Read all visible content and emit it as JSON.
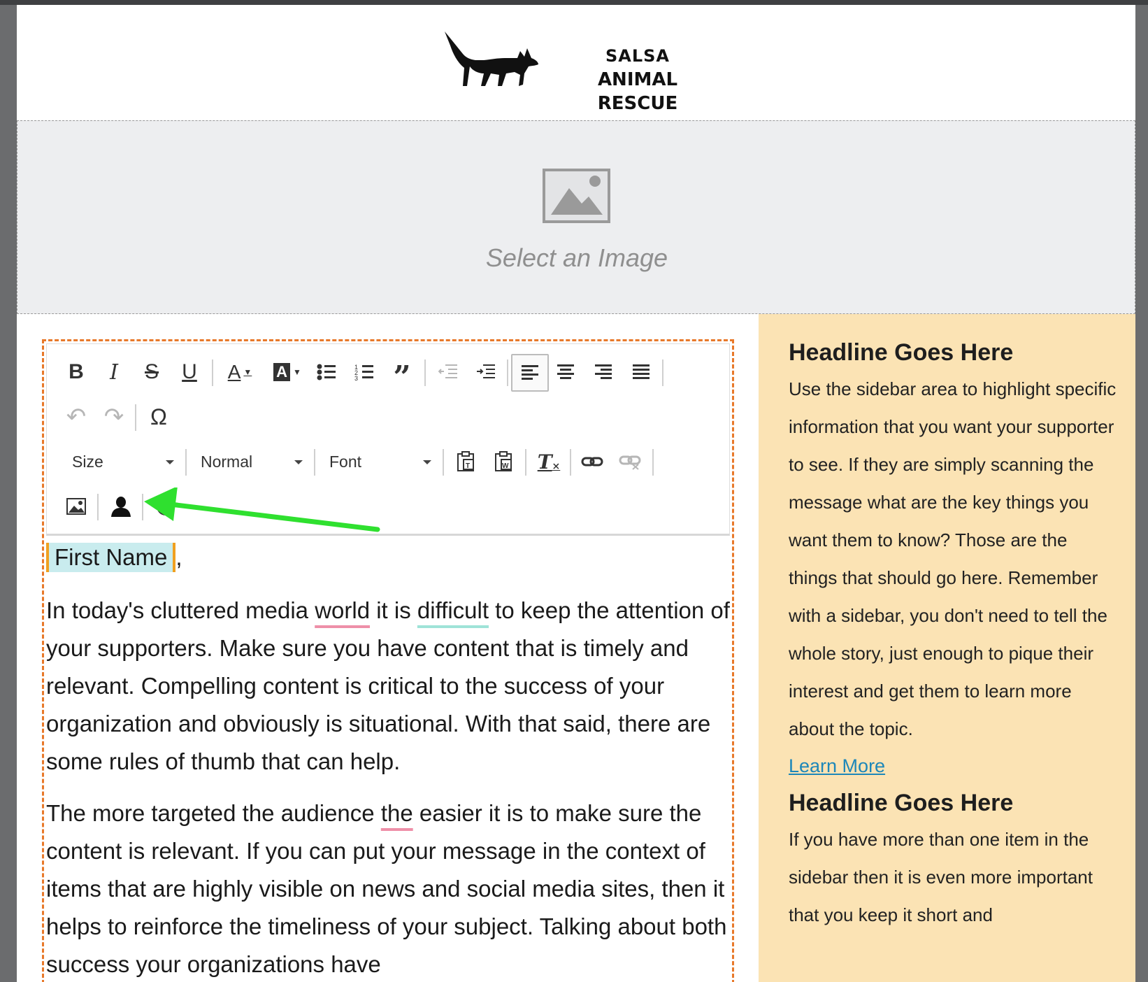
{
  "brand": {
    "line1": "SALSA",
    "line2": "ANIMAL RESCUE",
    "logo_icon": "fox-icon"
  },
  "image_block": {
    "label": "Select an Image",
    "icon": "image-placeholder-icon"
  },
  "toolbar": {
    "row1": [
      "B",
      "I",
      "S",
      "U",
      "A",
      "A"
    ],
    "size_label": "Size",
    "format_label": "Normal",
    "font_label": "Font"
  },
  "content": {
    "greeting_token": "First Name",
    "greeting_suffix": ",",
    "p1": {
      "s1": "In today's cluttered media ",
      "w1": "world",
      "s2": " it is ",
      "w2": "difficult",
      "s3": " to keep the attention of your supporters. Make sure you have content that is timely and relevant. Compelling content is critical to the success of your organization and obviously is situational. With that said, there are some rules of thumb that can help."
    },
    "p2": {
      "s1": "The more targeted the audience ",
      "w1": "the",
      "s2": " easier it is to make sure the content is relevant. If you can put your message in the context of items that are highly visible on news and social media sites, then it helps to reinforce the timeliness of your subject. Talking about both success your organizations have"
    }
  },
  "sidebar": {
    "headline1": "Headline Goes Here",
    "text1": "Use the sidebar area to highlight specific information that you want your supporter to see. If they are simply scanning the message what are the key things you want them to know? Those are the things that should go here. Remember with a sidebar, you don't need to tell the whole story, just enough to pique their interest and get them to learn more about the topic.",
    "link": "Learn More",
    "headline2": "Headline Goes Here",
    "text2": "If you have more than one item in the sidebar then it is even more important that you keep it short and"
  },
  "colors": {
    "editor_border": "#e8792a",
    "sidebar_bg": "#fbe3b4",
    "arrow": "#2fe02f",
    "token_bg": "#c9ecee",
    "link": "#1d87b9"
  }
}
